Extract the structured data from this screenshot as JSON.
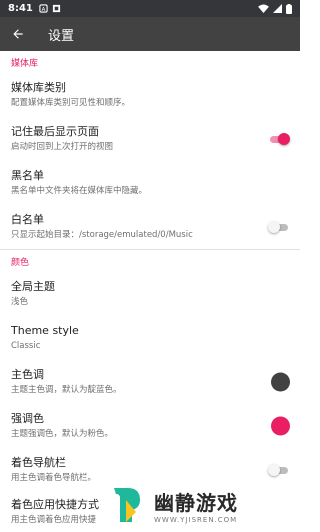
{
  "statusbar": {
    "time": "8:41"
  },
  "appbar": {
    "title": "设置"
  },
  "sections": {
    "library": {
      "header": "媒体库"
    },
    "colors": {
      "header": "颜色"
    }
  },
  "prefs": {
    "library_categories": {
      "title": "媒体库类别",
      "summary": "配置媒体库类别可见性和顺序。"
    },
    "remember_last_tab": {
      "title": "记住最后显示页面",
      "summary": "启动时回到上次打开的视图",
      "checked": true
    },
    "blacklist": {
      "title": "黑名单",
      "summary": "黑名单中文件夹将在媒体库中隐藏。"
    },
    "whitelist": {
      "title": "白名单",
      "summary": "只显示起始目录：/storage/emulated/0/Music",
      "checked": false
    },
    "general_theme": {
      "title": "全局主题",
      "summary": "浅色"
    },
    "theme_style": {
      "title": "Theme style",
      "summary": "Classic"
    },
    "primary_color": {
      "title": "主色调",
      "summary": "主题主色调，默认为靛蓝色。",
      "color": "#424242"
    },
    "accent_color": {
      "title": "强调色",
      "summary": "主题强调色，默认为粉色。",
      "color": "#e91e63"
    },
    "colored_navbar": {
      "title": "着色导航栏",
      "summary": "用主色调着色导航栏。",
      "checked": false
    },
    "colored_shortcuts": {
      "title": "着色应用快捷方式",
      "summary": "用主色调着色应用快捷"
    }
  },
  "watermark": {
    "text": "幽静游戏",
    "url": "WWW.YJISREN.COM"
  },
  "colors": {
    "accent": "#e91e63",
    "toolbar": "#424242",
    "statusbar": "#35363a"
  },
  "icons": [
    "back-arrow-icon",
    "wifi-icon",
    "battery-icon"
  ]
}
